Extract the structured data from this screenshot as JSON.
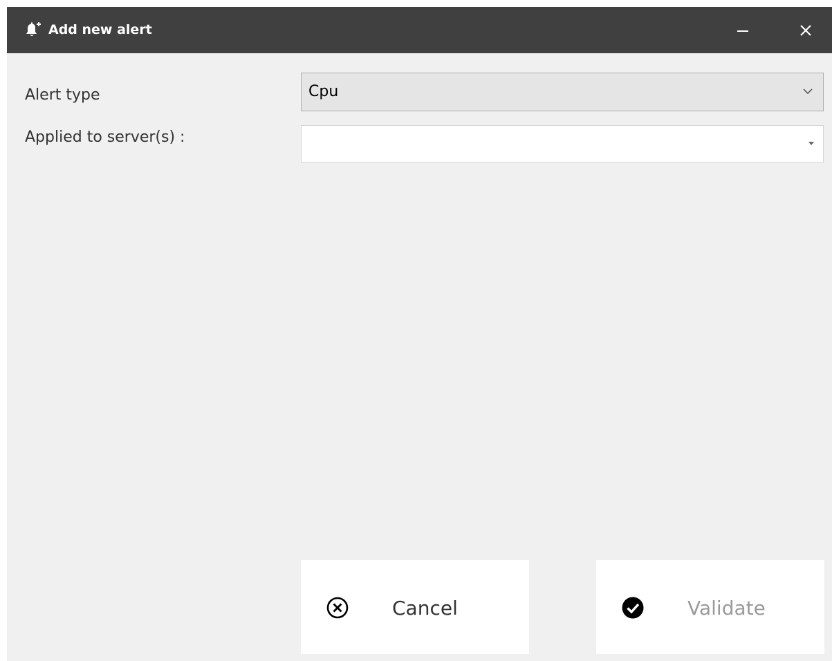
{
  "window": {
    "title": "Add new alert",
    "title_icon": "bell-plus-icon",
    "minimize_icon": "minimize-icon",
    "close_icon": "close-icon"
  },
  "form": {
    "alert_type_label": "Alert type",
    "alert_type_value": "Cpu",
    "servers_label": "Applied to server(s) :",
    "servers_value": ""
  },
  "actions": {
    "cancel_label": "Cancel",
    "cancel_icon": "circle-x-icon",
    "validate_label": "Validate",
    "validate_icon": "circle-check-icon"
  },
  "colors": {
    "titlebar": "#404040",
    "background": "#f0f0f0",
    "disabled_text": "#9a9a9a"
  }
}
